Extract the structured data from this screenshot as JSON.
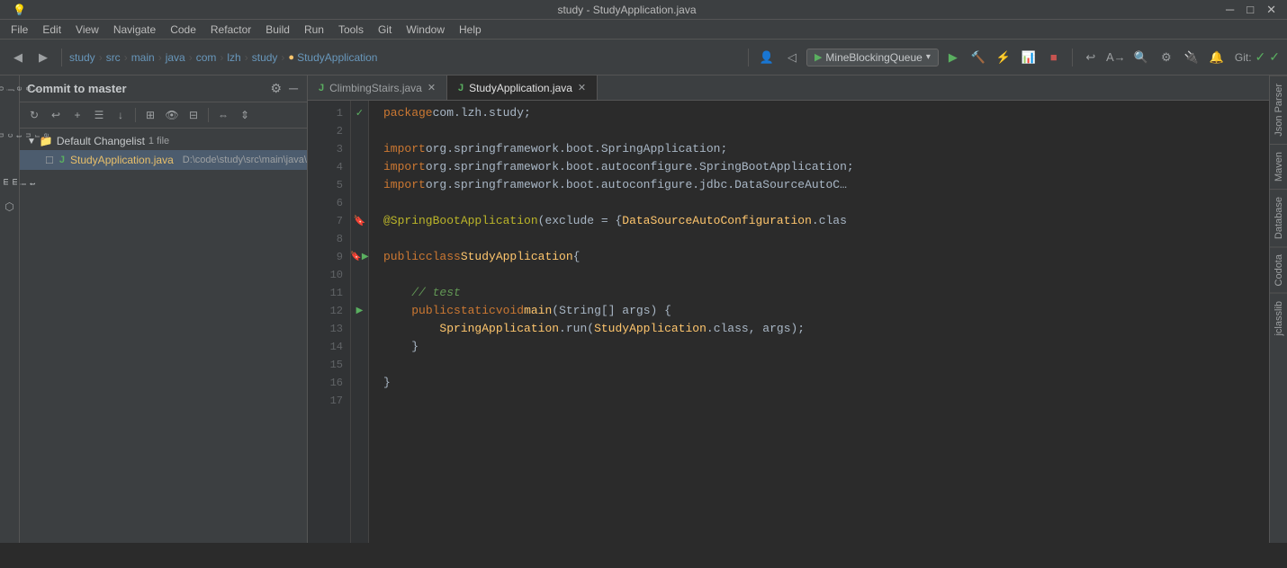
{
  "window": {
    "title": "study - StudyApplication.java",
    "icon": "💡"
  },
  "menubar": {
    "items": [
      "File",
      "Edit",
      "View",
      "Navigate",
      "Code",
      "Refactor",
      "Build",
      "Run",
      "Tools",
      "Git",
      "Window",
      "Help"
    ]
  },
  "breadcrumb": {
    "parts": [
      "study",
      "src",
      "main",
      "java",
      "com",
      "lzh",
      "study",
      "StudyApplication"
    ]
  },
  "toolbar": {
    "run_config": "MineBlockingQueue",
    "git_status": "Git:",
    "search_icon": "🔍"
  },
  "commit_panel": {
    "title": "Commit to master",
    "changelist": {
      "name": "Default Changelist",
      "count": "1 file",
      "files": [
        {
          "name": "StudyApplication.java",
          "path": "D:\\code\\study\\src\\main\\java\\com\\lzh\\study",
          "icon": "J"
        }
      ]
    }
  },
  "editor": {
    "tabs": [
      {
        "name": "ClimbingStairs.java",
        "active": false
      },
      {
        "name": "StudyApplication.java",
        "active": true
      }
    ],
    "lines": [
      {
        "num": 1,
        "tokens": [
          {
            "t": "package ",
            "c": "kw"
          },
          {
            "t": "com.lzh.study",
            "c": "pk"
          },
          {
            "t": ";",
            "c": "op"
          }
        ],
        "gutter": "✓",
        "gutter_color": "status-check"
      },
      {
        "num": 2,
        "tokens": [],
        "gutter": ""
      },
      {
        "num": 3,
        "tokens": [
          {
            "t": "import ",
            "c": "kw"
          },
          {
            "t": "org.springframework.boot.SpringApplication",
            "c": "pk"
          },
          {
            "t": ";",
            "c": "op"
          }
        ],
        "gutter": ""
      },
      {
        "num": 4,
        "tokens": [
          {
            "t": "import ",
            "c": "kw"
          },
          {
            "t": "org.springframework.boot.autoconfigure.SpringBootApplication",
            "c": "pk"
          },
          {
            "t": ";",
            "c": "op"
          }
        ],
        "gutter": ""
      },
      {
        "num": 5,
        "tokens": [
          {
            "t": "import ",
            "c": "kw"
          },
          {
            "t": "org.springframework.boot.autoconfigure.jdbc.DataSourceAutoC",
            "c": "pk"
          },
          {
            "t": ";",
            "c": "op"
          }
        ],
        "gutter": ""
      },
      {
        "num": 6,
        "tokens": [],
        "gutter": ""
      },
      {
        "num": 7,
        "tokens": [
          {
            "t": "@SpringBootApplication",
            "c": "an"
          },
          {
            "t": "(exclude = { ",
            "c": "pk"
          },
          {
            "t": "DataSourceAutoConfiguration",
            "c": "cl"
          },
          {
            "t": ".clas",
            "c": "pk"
          }
        ],
        "gutter": "",
        "has_bookmark": true
      },
      {
        "num": 8,
        "tokens": [],
        "gutter": ""
      },
      {
        "num": 9,
        "tokens": [
          {
            "t": "public ",
            "c": "kw"
          },
          {
            "t": "class ",
            "c": "kw"
          },
          {
            "t": "StudyApplication",
            "c": "cl"
          },
          {
            "t": " {",
            "c": "op"
          }
        ],
        "gutter": "",
        "has_bookmark": true,
        "has_run": true,
        "fold": true
      },
      {
        "num": 10,
        "tokens": [],
        "gutter": ""
      },
      {
        "num": 11,
        "tokens": [
          {
            "t": "    ",
            "c": "pk"
          },
          {
            "t": "// test",
            "c": "cm"
          }
        ],
        "gutter": ""
      },
      {
        "num": 12,
        "tokens": [
          {
            "t": "    ",
            "c": "pk"
          },
          {
            "t": "public ",
            "c": "kw"
          },
          {
            "t": "static ",
            "c": "kw"
          },
          {
            "t": "void ",
            "c": "kw"
          },
          {
            "t": "main",
            "c": "cl"
          },
          {
            "t": "(String[] args) {",
            "c": "pk"
          }
        ],
        "gutter": "",
        "has_run": true,
        "fold": true
      },
      {
        "num": 13,
        "tokens": [
          {
            "t": "        ",
            "c": "pk"
          },
          {
            "t": "SpringApplication",
            "c": "cl"
          },
          {
            "t": ".run(",
            "c": "pk"
          },
          {
            "t": "StudyApplication",
            "c": "cl"
          },
          {
            "t": ".class, args);",
            "c": "pk"
          }
        ],
        "gutter": ""
      },
      {
        "num": 14,
        "tokens": [
          {
            "t": "    }",
            "c": "op"
          }
        ],
        "gutter": "",
        "fold": true
      },
      {
        "num": 15,
        "tokens": [],
        "gutter": ""
      },
      {
        "num": 16,
        "tokens": [
          {
            "t": "}",
            "c": "op"
          }
        ],
        "gutter": ""
      },
      {
        "num": 17,
        "tokens": [],
        "gutter": ""
      }
    ]
  },
  "right_sidebar": {
    "tabs": [
      "Json Parser",
      "Maven",
      "Database",
      "Codota",
      "jclasslib"
    ]
  },
  "left_sidebar": {
    "icons": [
      "▶",
      "📁",
      "☰",
      "⚙",
      "✎",
      "⬡"
    ]
  }
}
